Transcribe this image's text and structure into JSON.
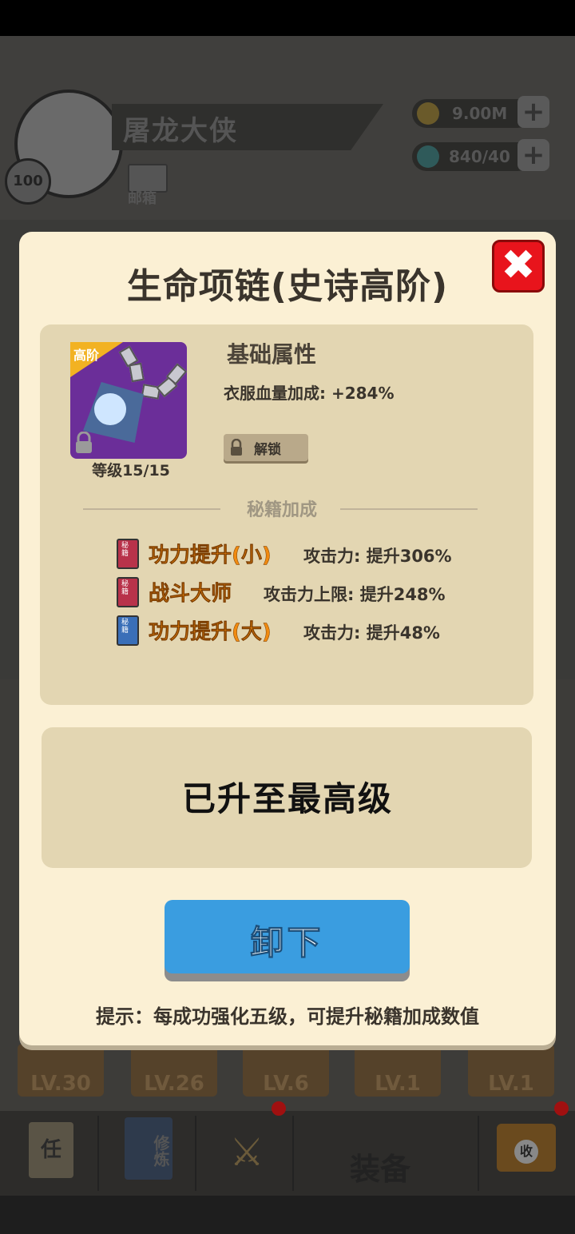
{
  "header": {
    "player_name": "屠龙大侠",
    "level": "100",
    "mail_label": "邮箱",
    "gold": "9.00M",
    "gems": "840/40"
  },
  "slots": [
    "LV.30",
    "LV.26",
    "LV.6",
    "LV.1",
    "LV.1"
  ],
  "tabs": [
    {
      "label": "任"
    },
    {
      "label": "修炼"
    },
    {
      "label": ""
    },
    {
      "label": "装备"
    },
    {
      "label": "收"
    }
  ],
  "modal": {
    "title": "生命项链(史诗高阶)",
    "tier_badge": "高阶",
    "item_level": "等级15/15",
    "base_section_title": "基础属性",
    "base_attr": "衣服血量加成: +284%",
    "unlock_label": "解锁",
    "secret_section_title": "秘籍加成",
    "skills": [
      {
        "name": "功力提升(小)",
        "effect": "攻击力: 提升306%",
        "book_color": "#b8324a",
        "book_glyph": "秘籍"
      },
      {
        "name": "战斗大师",
        "effect": "攻击力上限: 提升248%",
        "book_color": "#b8324a",
        "book_glyph": "秘籍"
      },
      {
        "name": "功力提升(大)",
        "effect": "攻击力: 提升48%",
        "book_color": "#3a6fb8",
        "book_glyph": "秘籍"
      }
    ],
    "max_level_text": "已升至最高级",
    "unequip_label": "卸下",
    "hint": "提示：每成功强化五级，可提升秘籍加成数值"
  },
  "colors": {
    "accent_blue": "#3a9de0",
    "skill_orange": "#f08a10",
    "close_red": "#e8141c",
    "modal_bg": "#fbf0d4",
    "panel_bg": "#e3d6b2"
  }
}
